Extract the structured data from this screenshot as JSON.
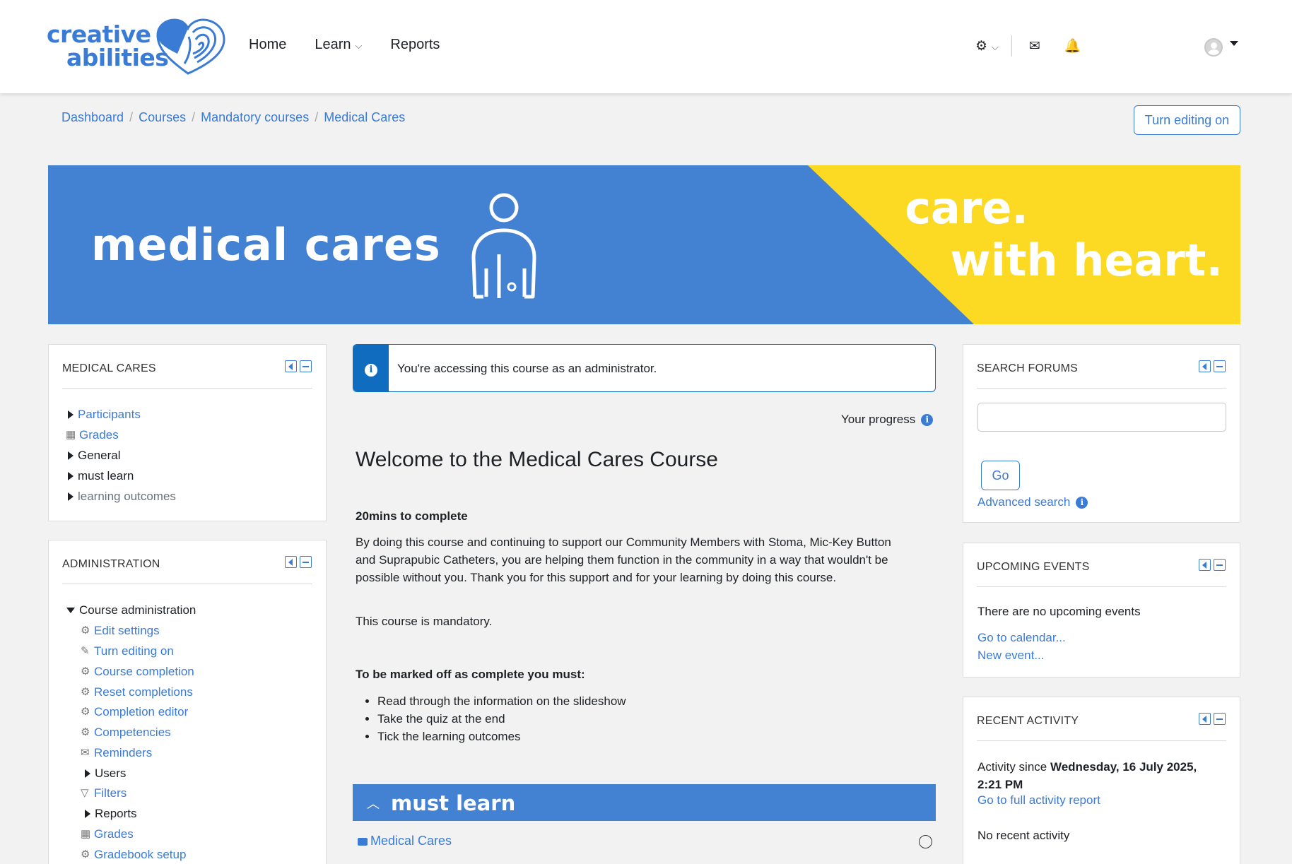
{
  "brand": {
    "line1": "creative",
    "line2": "abilities"
  },
  "nav": {
    "home": "Home",
    "learn": "Learn",
    "reports": "Reports"
  },
  "breadcrumb": [
    "Dashboard",
    "Courses",
    "Mandatory courses",
    "Medical Cares"
  ],
  "edit_button": "Turn editing on",
  "banner": {
    "title": "medical cares",
    "tagline1": "care.",
    "tagline2": "with heart."
  },
  "blocks": {
    "course_nav": {
      "title": "MEDICAL CARES",
      "items": [
        {
          "label": "Participants"
        },
        {
          "label": "Grades"
        },
        {
          "label": "General"
        },
        {
          "label": "must learn"
        },
        {
          "label": "learning outcomes"
        }
      ]
    },
    "admin": {
      "title": "ADMINISTRATION",
      "root": "Course administration",
      "items": [
        {
          "label": "Edit settings"
        },
        {
          "label": "Turn editing on"
        },
        {
          "label": "Course completion"
        },
        {
          "label": "Reset completions"
        },
        {
          "label": "Completion editor"
        },
        {
          "label": "Competencies"
        },
        {
          "label": "Reminders"
        },
        {
          "label": "Users"
        },
        {
          "label": "Filters"
        },
        {
          "label": "Reports"
        },
        {
          "label": "Grades"
        },
        {
          "label": "Gradebook setup"
        }
      ]
    },
    "search_forums": {
      "title": "SEARCH FORUMS",
      "go_label": "Go",
      "advanced": "Advanced search"
    },
    "upcoming": {
      "title": "UPCOMING EVENTS",
      "empty": "There are no upcoming events",
      "calendar_link": "Go to calendar...",
      "new_event": "New event..."
    },
    "recent": {
      "title": "RECENT ACTIVITY",
      "since_prefix": "Activity since ",
      "since_date": "Wednesday, 16 July 2025, 2:21 PM",
      "full_report": "Go to full activity report",
      "empty": "No recent activity"
    }
  },
  "main": {
    "alert": "You're accessing this course as an administrator.",
    "progress_label": "Your progress",
    "welcome": "Welcome to the Medical Cares Course",
    "duration": "20mins to complete",
    "intro": "By doing this course and continuing to support our Community Members with Stoma, Mic-Key Button and Suprapubic Catheters, you are helping them function in the community in a way that wouldn't be possible without you. Thank you for this support and for your learning by doing this course.",
    "mandatory": "This course is mandatory.",
    "requirements_heading": "To be marked off as complete you must:",
    "requirements": [
      "Read through the information on the slideshow",
      "Take the quiz at the end",
      "Tick the learning outcomes"
    ],
    "section_title": "must learn",
    "activity": "Medical Cares"
  },
  "colors": {
    "accent": "#3a7bd5",
    "banner_blue": "#4381d2",
    "banner_yellow": "#fcd922",
    "alert_blue": "#0f6cbf"
  }
}
